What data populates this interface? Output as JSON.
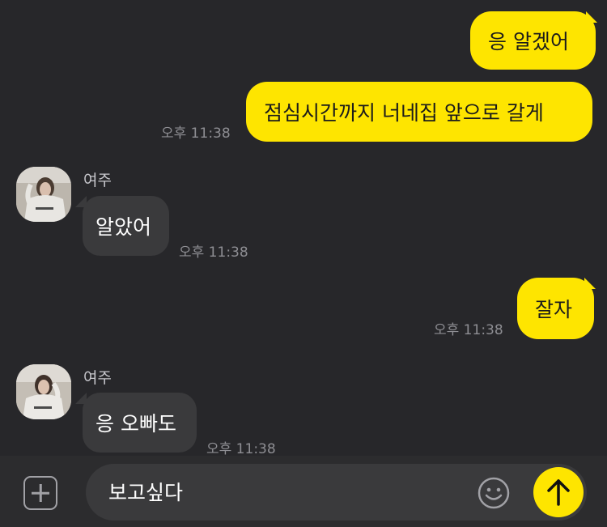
{
  "messages": [
    {
      "type": "out",
      "text": "응 알겠어"
    },
    {
      "type": "out",
      "text": "점심시간까지 너네집 앞으로 갈게",
      "time": "오후 11:38"
    },
    {
      "type": "in",
      "sender": "여주",
      "text": "알았어",
      "time": "오후 11:38"
    },
    {
      "type": "out",
      "text": "잘자",
      "time": "오후 11:38"
    },
    {
      "type": "in",
      "sender": "여주",
      "text": "응 오빠도",
      "time": "오후 11:38"
    }
  ],
  "input": {
    "value": "보고싶다"
  },
  "icons": {
    "attach": "plus-icon",
    "emoji": "smiley-icon",
    "send": "arrow-up-icon"
  },
  "colors": {
    "background": "#27272a",
    "outgoing_bubble": "#fee500",
    "incoming_bubble": "#3a3a3c",
    "send_button": "#fee500"
  }
}
